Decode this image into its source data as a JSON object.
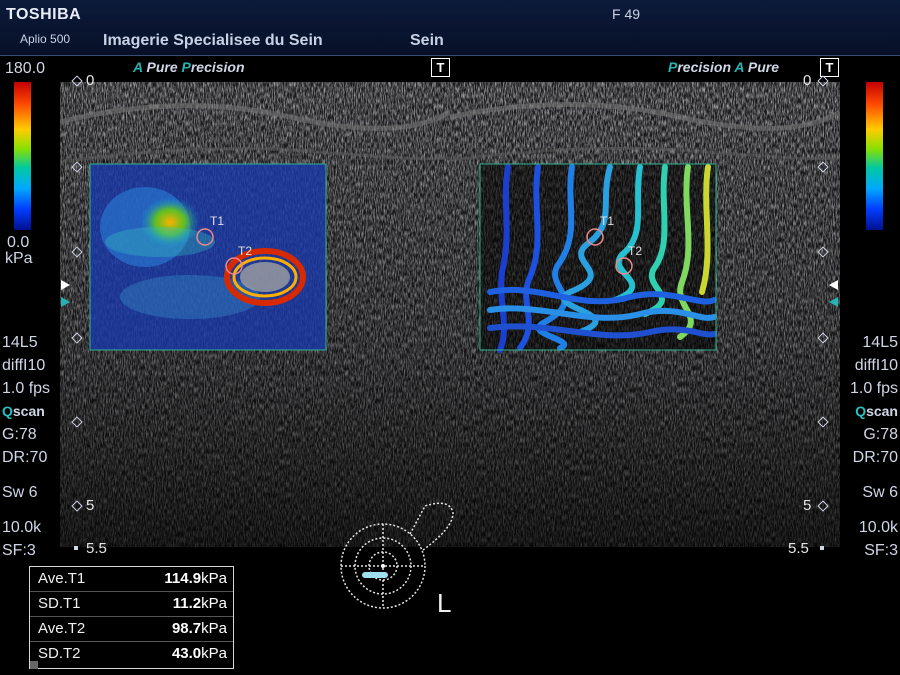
{
  "header": {
    "brand": "TOSHIBA",
    "model": "Aplio 500",
    "institution": "Imagerie Specialisee du Sein",
    "exam": "Sein",
    "frame_counter": "F 49"
  },
  "left_view": {
    "mode_a": "A",
    "mode_a_label": "Pure",
    "mode_p": "P",
    "mode_p_label": "recision",
    "t_marker": "T",
    "depth_top": "0",
    "depth_5": "5",
    "depth_bottom": "5.5",
    "roi_t1": "T1",
    "roi_t2": "T2"
  },
  "right_view": {
    "mode_p": "P",
    "mode_p_label": "recision",
    "mode_a": "A",
    "mode_a_label": "Pure",
    "t_marker": "T",
    "depth_top": "0",
    "depth_5": "5",
    "depth_bottom": "5.5",
    "roi_t1": "T1",
    "roi_t2": "T2"
  },
  "colorbar": {
    "max": "180.0",
    "min": "0.0",
    "unit": "kPa"
  },
  "left_params": {
    "probe": "14L5",
    "filter": "diffI10",
    "fps": "1.0 fps",
    "qscan_q": "Q",
    "qscan_rest": "scan",
    "gain": "G:78",
    "dr": "DR:70",
    "sw": "Sw 6",
    "prf": "10.0k",
    "sf": "SF:3"
  },
  "right_params": {
    "probe": "14L5",
    "filter": "diffI10",
    "fps": "1.0 fps",
    "qscan_q": "Q",
    "qscan_rest": "scan",
    "gain": "G:78",
    "dr": "DR:70",
    "sw": "Sw 6",
    "prf": "10.0k",
    "sf": "SF:3"
  },
  "measurements": [
    {
      "label": "Ave.T1",
      "value": "114.9",
      "unit": "kPa"
    },
    {
      "label": "SD.T1",
      "value": "11.2",
      "unit": "kPa"
    },
    {
      "label": "Ave.T2",
      "value": "98.7",
      "unit": "kPa"
    },
    {
      "label": "SD.T2",
      "value": "43.0",
      "unit": "kPa"
    }
  ],
  "orientation": "L",
  "colors": {
    "accent_cyan": "#27b3b3",
    "header_bg": "#0c1a3a"
  }
}
